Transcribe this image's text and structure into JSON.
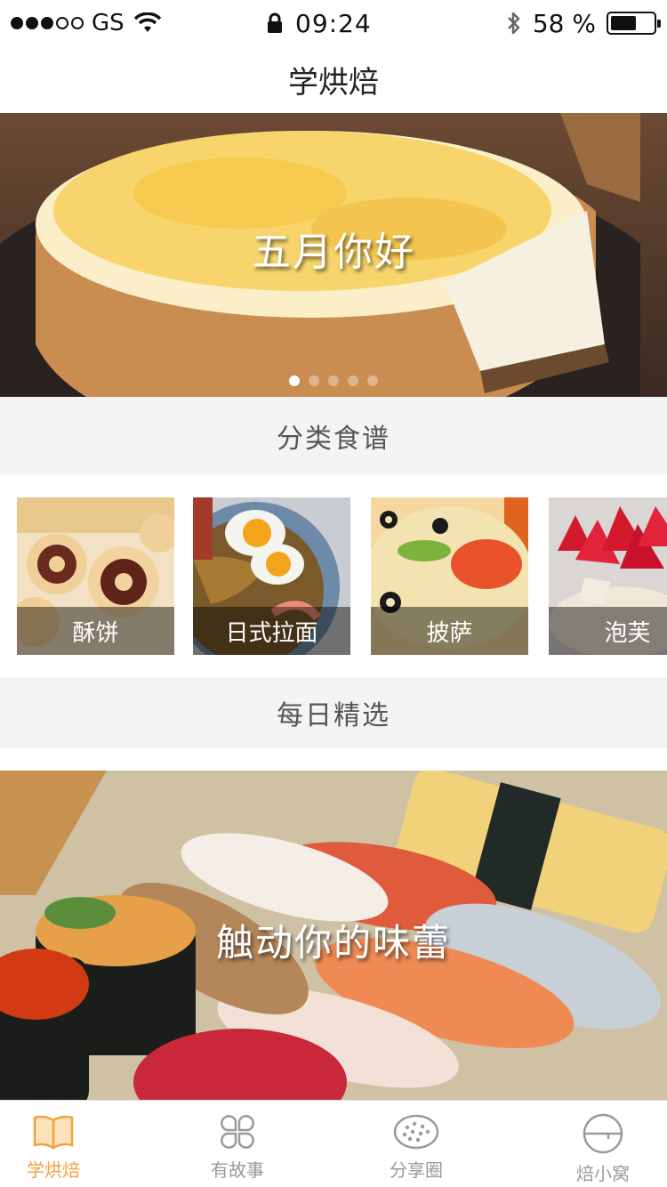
{
  "status_bar": {
    "signal_dots_filled": 3,
    "signal_dots_total": 5,
    "carrier": "GS",
    "time": "09:24",
    "battery_percent": "58 %",
    "battery_level": 0.58
  },
  "nav": {
    "title": "学烘焙"
  },
  "banner": {
    "caption": "五月你好",
    "page_count": 5,
    "active_page": 0
  },
  "category_section": {
    "title": "分类食谱"
  },
  "categories": [
    {
      "label": "酥饼"
    },
    {
      "label": "日式拉面"
    },
    {
      "label": "披萨"
    },
    {
      "label": "泡芙"
    }
  ],
  "daily_section": {
    "title": "每日精选"
  },
  "daily_banner": {
    "caption": "触动你的味蕾"
  },
  "tabs": [
    {
      "label": "学烘焙",
      "icon": "book-icon",
      "active": true
    },
    {
      "label": "有故事",
      "icon": "clover-icon",
      "active": false
    },
    {
      "label": "分享圈",
      "icon": "cookie-icon",
      "active": false
    },
    {
      "label": "焙小窝",
      "icon": "bowl-icon",
      "active": false
    }
  ],
  "colors": {
    "accent": "#f1a23c",
    "inactive": "#9a9a9a",
    "section_bg": "#f4f4f4"
  }
}
